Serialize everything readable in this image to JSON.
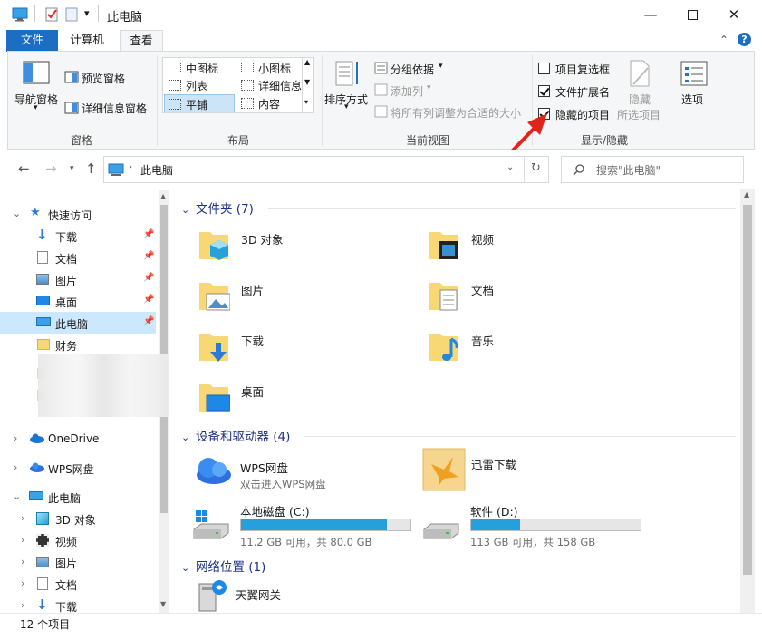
{
  "window": {
    "title": "此电脑"
  },
  "tabs": {
    "file": "文件",
    "computer": "计算机",
    "view": "查看"
  },
  "ribbon": {
    "pane_group": {
      "nav_pane": "导航窗格",
      "preview_pane": "预览窗格",
      "details_pane": "详细信息窗格",
      "label": "窗格"
    },
    "layout_group": {
      "items": [
        "中图标",
        "小图标",
        "列表",
        "详细信息",
        "平铺",
        "内容"
      ],
      "selected": "平铺",
      "label": "布局"
    },
    "current_view_group": {
      "sort_by": "排序方式",
      "group_by": "分组依据",
      "add_column": "添加列",
      "size_all": "将所有列调整为合适的大小",
      "label": "当前视图"
    },
    "show_hide_group": {
      "item_checkboxes": {
        "label": "项目复选框",
        "checked": false
      },
      "file_extensions": {
        "label": "文件扩展名",
        "checked": true
      },
      "hidden_items": {
        "label": "隐藏的项目",
        "checked": true
      },
      "hide_selected_line1": "隐藏",
      "hide_selected_line2": "所选项目",
      "label": "显示/隐藏"
    },
    "options": "选项"
  },
  "address": {
    "path": "此电脑",
    "search_placeholder": "搜索\"此电脑\""
  },
  "nav_pane": {
    "quick_access": "快速访问",
    "quick_items": [
      "下载",
      "文档",
      "图片",
      "桌面",
      "此电脑",
      "财务"
    ],
    "onedrive": "OneDrive",
    "wps": "WPS网盘",
    "this_pc": "此电脑",
    "pc_items": [
      "3D 对象",
      "视频",
      "图片",
      "文档",
      "下载"
    ]
  },
  "content": {
    "folders_header": "文件夹 (7)",
    "folders": [
      "3D 对象",
      "视频",
      "图片",
      "文档",
      "下载",
      "音乐",
      "桌面"
    ],
    "devices_header": "设备和驱动器 (4)",
    "wps": {
      "name": "WPS网盘",
      "sub": "双击进入WPS网盘"
    },
    "xunlei": {
      "name": "迅雷下载"
    },
    "drives": [
      {
        "name": "本地磁盘 (C:)",
        "free": "11.2 GB 可用，共 80.0 GB",
        "used_fraction": 0.86
      },
      {
        "name": "软件 (D:)",
        "free": "113 GB 可用，共 158 GB",
        "used_fraction": 0.29
      }
    ],
    "network_header": "网络位置 (1)",
    "network": [
      "天翼网关"
    ]
  },
  "status": {
    "count": "12 个项目"
  },
  "colors": {
    "accent": "#1b6ec2",
    "folder": "#f8d775",
    "drive_fill": "#26a0da",
    "annotation": "#e2231a"
  }
}
